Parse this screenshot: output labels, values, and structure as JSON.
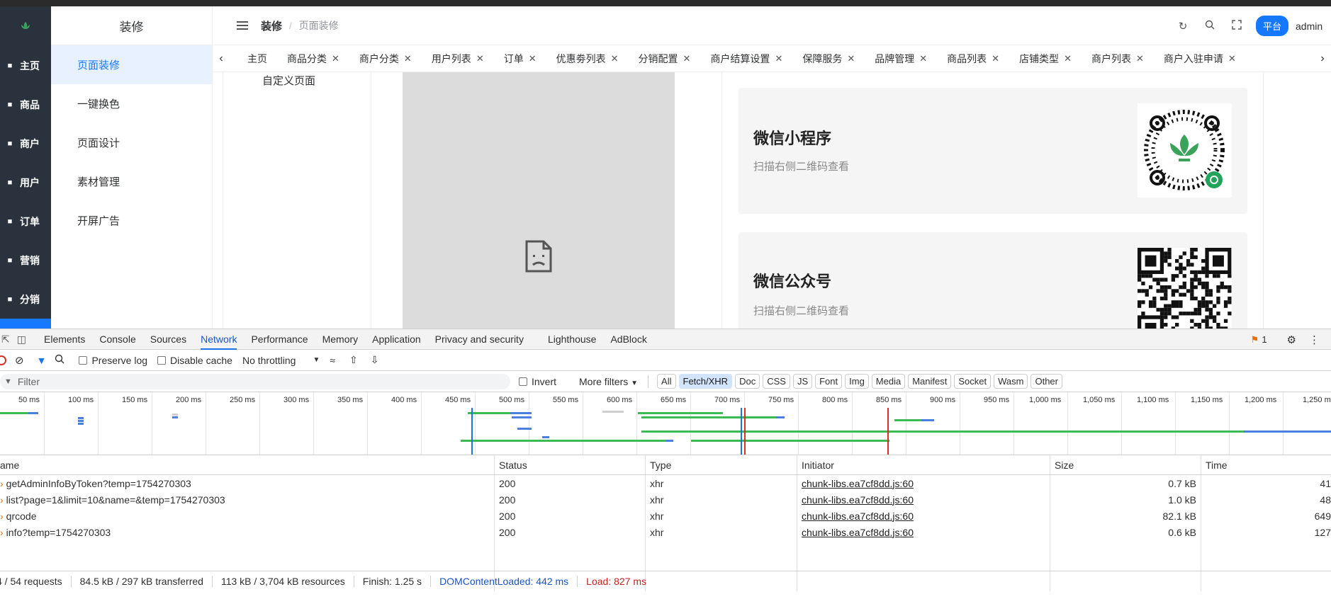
{
  "sidebar": {
    "items": [
      {
        "label": "主页",
        "icon": "grid-icon"
      },
      {
        "label": "商品",
        "icon": "bag-icon"
      },
      {
        "label": "商户",
        "icon": "store-icon"
      },
      {
        "label": "用户",
        "icon": "user-icon"
      },
      {
        "label": "订单",
        "icon": "clipboard-icon"
      },
      {
        "label": "营销",
        "icon": "chart-icon"
      },
      {
        "label": "分销",
        "icon": "person-icon"
      }
    ]
  },
  "submenu": {
    "title": "装修",
    "items": [
      "页面装修",
      "一键换色",
      "页面设计",
      "素材管理",
      "开屏广告"
    ],
    "active": "页面装修"
  },
  "header": {
    "crumb1": "装修",
    "crumb2": "页面装修",
    "badge": "平台",
    "user": "admin"
  },
  "tabs": [
    "主页",
    "商品分类",
    "商户分类",
    "用户列表",
    "订单",
    "优惠劵列表",
    "分销配置",
    "商户结算设置",
    "保障服务",
    "品牌管理",
    "商品列表",
    "店铺类型",
    "商户列表",
    "商户入驻申请"
  ],
  "content": {
    "left_label": "自定义页面",
    "cards": [
      {
        "title": "微信小程序",
        "subtitle": "扫描右侧二维码查看"
      },
      {
        "title": "微信公众号",
        "subtitle": "扫描右侧二维码查看"
      }
    ]
  },
  "devtools": {
    "tabs": [
      "Elements",
      "Console",
      "Sources",
      "Network",
      "Performance",
      "Memory",
      "Application",
      "Privacy and security",
      "Lighthouse",
      "AdBlock"
    ],
    "active_tab": "Network",
    "issues_count": "1",
    "toolbar": {
      "preserve_log": "Preserve log",
      "disable_cache": "Disable cache",
      "throttling": "No throttling"
    },
    "filter": {
      "placeholder": "Filter",
      "invert": "Invert",
      "more_filters": "More filters"
    },
    "types": [
      "All",
      "Fetch/XHR",
      "Doc",
      "CSS",
      "JS",
      "Font",
      "Img",
      "Media",
      "Manifest",
      "Socket",
      "Wasm",
      "Other"
    ],
    "active_type": "Fetch/XHR",
    "timeline_ticks": [
      "50 ms",
      "100 ms",
      "150 ms",
      "200 ms",
      "250 ms",
      "300 ms",
      "350 ms",
      "400 ms",
      "450 ms",
      "500 ms",
      "550 ms",
      "600 ms",
      "650 ms",
      "700 ms",
      "750 ms",
      "800 ms",
      "850 ms",
      "900 ms",
      "950 ms",
      "1,000 ms",
      "1,050 ms",
      "1,100 ms",
      "1,150 ms",
      "1,200 ms",
      "1,250 m"
    ],
    "columns": [
      "ame",
      "Status",
      "Type",
      "Initiator",
      "Size",
      "Time"
    ],
    "rows": [
      {
        "name": "getAdminInfoByToken?temp=1754270303",
        "status": "200",
        "type": "xhr",
        "initiator": "chunk-libs.ea7cf8dd.js:60",
        "size": "0.7 kB",
        "time": "41"
      },
      {
        "name": "list?page=1&limit=10&name=&temp=1754270303",
        "status": "200",
        "type": "xhr",
        "initiator": "chunk-libs.ea7cf8dd.js:60",
        "size": "1.0 kB",
        "time": "48"
      },
      {
        "name": "qrcode",
        "status": "200",
        "type": "xhr",
        "initiator": "chunk-libs.ea7cf8dd.js:60",
        "size": "82.1 kB",
        "time": "649"
      },
      {
        "name": "info?temp=1754270303",
        "status": "200",
        "type": "xhr",
        "initiator": "chunk-libs.ea7cf8dd.js:60",
        "size": "0.6 kB",
        "time": "127"
      }
    ],
    "status": {
      "requests": "4 / 54 requests",
      "transferred": "84.5 kB / 297 kB transferred",
      "resources": "113 kB / 3,704 kB resources",
      "finish": "Finish: 1.25 s",
      "dcl": "DOMContentLoaded: 442 ms",
      "load": "Load: 827 ms"
    }
  }
}
